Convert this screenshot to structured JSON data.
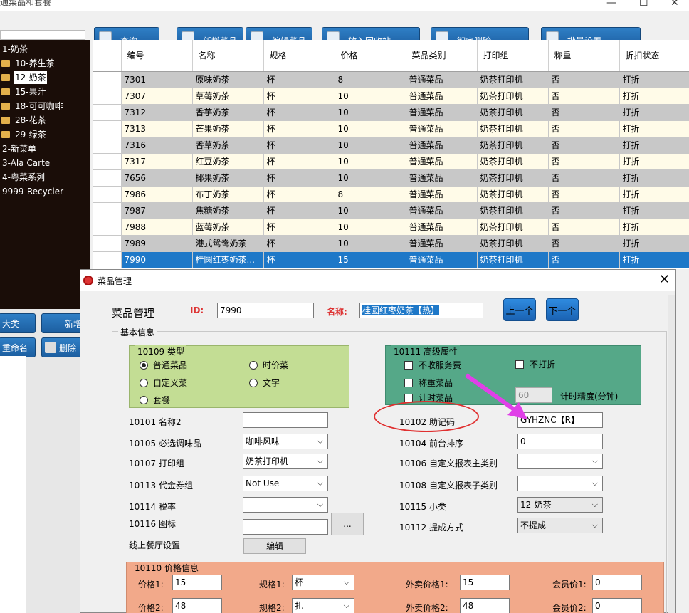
{
  "window": {
    "title": "通菜品和套餐"
  },
  "toolbar": {
    "buttons": [
      "查询",
      "新增菜品",
      "编辑菜品",
      "放入回收站",
      "彻底删除",
      "批量设置"
    ]
  },
  "tree": {
    "items": [
      {
        "label": "1-奶茶",
        "child": false,
        "selected": false
      },
      {
        "label": "10-养生茶",
        "child": true,
        "selected": false
      },
      {
        "label": "12-奶茶",
        "child": true,
        "selected": true
      },
      {
        "label": "15-果汁",
        "child": true,
        "selected": false
      },
      {
        "label": "18-可可咖啡",
        "child": true,
        "selected": false
      },
      {
        "label": "28-花茶",
        "child": true,
        "selected": false
      },
      {
        "label": "29-绿茶",
        "child": true,
        "selected": false
      },
      {
        "label": "2-新菜单",
        "child": false,
        "selected": false
      },
      {
        "label": "3-Ala Carte",
        "child": false,
        "selected": false
      },
      {
        "label": "4-粤菜系列",
        "child": false,
        "selected": false
      },
      {
        "label": "9999-Recycler",
        "child": false,
        "selected": false
      }
    ]
  },
  "left_buttons": {
    "big_category": "大类",
    "new": "新增",
    "rename": "重命名",
    "delete": "删除"
  },
  "grid": {
    "columns": [
      "编号",
      "名称",
      "规格",
      "价格",
      "菜品类别",
      "打印组",
      "称重",
      "折扣状态"
    ],
    "rows": [
      [
        "7301",
        "原味奶茶",
        "杯",
        "8",
        "普通菜品",
        "奶茶打印机",
        "否",
        "打折"
      ],
      [
        "7307",
        "草莓奶茶",
        "杯",
        "10",
        "普通菜品",
        "奶茶打印机",
        "否",
        "打折"
      ],
      [
        "7312",
        "香芋奶茶",
        "杯",
        "10",
        "普通菜品",
        "奶茶打印机",
        "否",
        "打折"
      ],
      [
        "7313",
        "芒果奶茶",
        "杯",
        "10",
        "普通菜品",
        "奶茶打印机",
        "否",
        "打折"
      ],
      [
        "7316",
        "香草奶茶",
        "杯",
        "10",
        "普通菜品",
        "奶茶打印机",
        "否",
        "打折"
      ],
      [
        "7317",
        "红豆奶茶",
        "杯",
        "10",
        "普通菜品",
        "奶茶打印机",
        "否",
        "打折"
      ],
      [
        "7656",
        "椰果奶茶",
        "杯",
        "10",
        "普通菜品",
        "奶茶打印机",
        "否",
        "打折"
      ],
      [
        "7986",
        "布丁奶茶",
        "杯",
        "8",
        "普通菜品",
        "奶茶打印机",
        "否",
        "打折"
      ],
      [
        "7987",
        "焦糖奶茶",
        "杯",
        "10",
        "普通菜品",
        "奶茶打印机",
        "否",
        "打折"
      ],
      [
        "7988",
        "蓝莓奶茶",
        "杯",
        "10",
        "普通菜品",
        "奶茶打印机",
        "否",
        "打折"
      ],
      [
        "7989",
        "港式鸳鸯奶茶",
        "杯",
        "10",
        "普通菜品",
        "奶茶打印机",
        "否",
        "打折"
      ],
      [
        "7990",
        "桂圆红枣奶茶...",
        "杯",
        "15",
        "普通菜品",
        "奶茶打印机",
        "否",
        "打折"
      ]
    ],
    "selected_index": 11
  },
  "dialog": {
    "title": "菜品管理",
    "heading": "菜品管理",
    "id_label": "ID:",
    "id_value": "7990",
    "name_label": "名称:",
    "name_value": "桂圆红枣奶茶【热】",
    "prev_button": "上一个",
    "next_button": "下一个",
    "basic_info_label": "基本信息",
    "type_group": {
      "legend": "10109 类型",
      "options": [
        "普通菜品",
        "时价菜",
        "自定义菜",
        "文字",
        "套餐"
      ],
      "selected": "普通菜品"
    },
    "advanced_group": {
      "legend": "10111 高级属性",
      "no_service_fee": "不收服务费",
      "no_discount": "不打折",
      "weighed": "称重菜品",
      "timed": "计时菜品",
      "timer_value": "60",
      "timer_precision_label": "计时精度(分钟)"
    },
    "fields": {
      "name2_label": "10101 名称2",
      "name2_value": "",
      "seasoning_label": "10105 必选调味品",
      "seasoning_value": "咖啡风味",
      "print_group_label": "10107 打印组",
      "print_group_value": "奶茶打印机",
      "voucher_label": "10113 代金券组",
      "voucher_value": "Not Use",
      "tax_label": "10114 税率",
      "tax_value": "",
      "icon_label": "10116 图标",
      "icon_value": "",
      "browse_button": "...",
      "online_label": "线上餐厅设置",
      "edit_button": "编辑",
      "mnemonic_label": "10102 助记码",
      "mnemonic_value": "GYHZNC【R】",
      "sort_label": "10104 前台排序",
      "sort_value": "0",
      "report_main_label": "10106 自定义报表主类别",
      "report_main_value": "",
      "report_sub_label": "10108 自定义报表子类别",
      "report_sub_value": "",
      "subcategory_label": "10115 小类",
      "subcategory_value": "12-奶茶",
      "commission_label": "10112 提成方式",
      "commission_value": "不提成"
    },
    "price_group": {
      "legend": "10110 价格信息",
      "rows": [
        {
          "price_label": "价格1:",
          "price": "15",
          "spec_label": "规格1:",
          "spec": "杯",
          "takeout_label": "外卖价格1:",
          "takeout": "15",
          "member_label": "会员价1:",
          "member": "0"
        },
        {
          "price_label": "价格2:",
          "price": "48",
          "spec_label": "规格2:",
          "spec": "扎",
          "takeout_label": "外卖价格2:",
          "takeout": "48",
          "member_label": "会员价2:",
          "member": "0"
        }
      ]
    }
  },
  "colors": {
    "accent": "#1e78c8",
    "annotation_circle": "#e03030",
    "annotation_arrow": "#e040e8"
  }
}
